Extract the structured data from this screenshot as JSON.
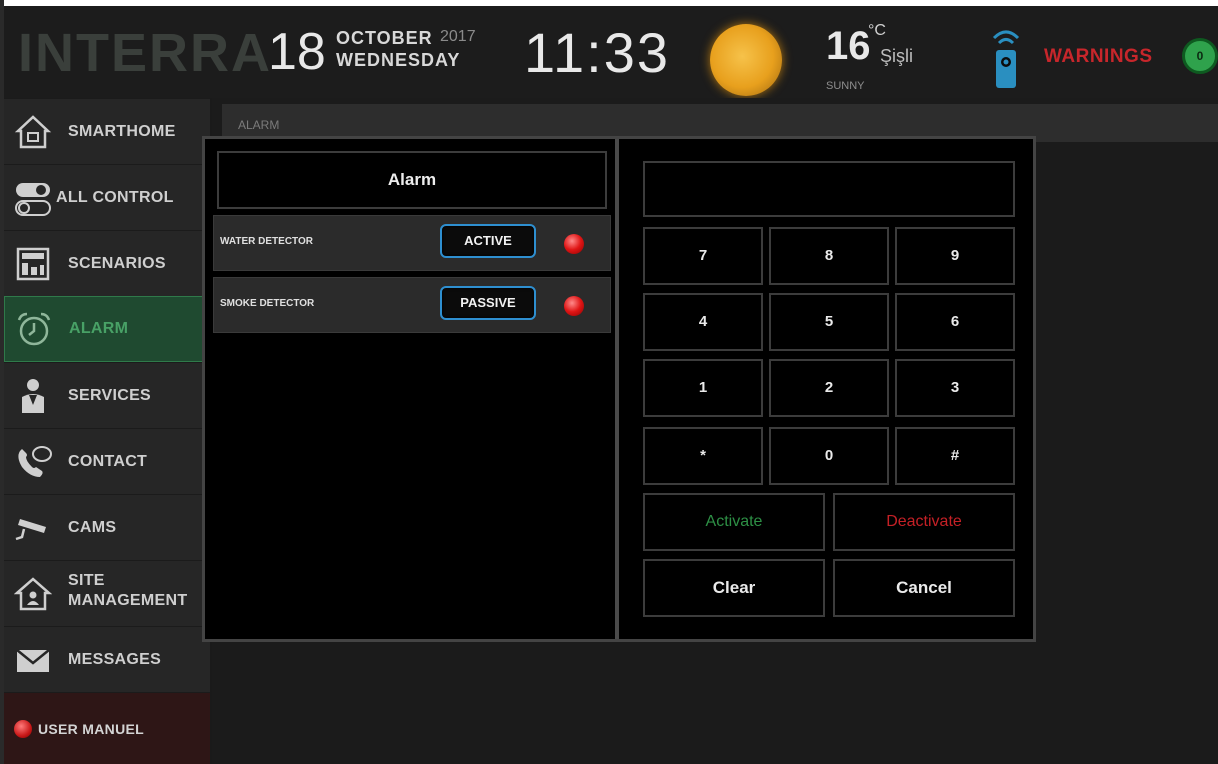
{
  "header": {
    "logo": "INTERRA",
    "day": "18",
    "month": "OCTOBER",
    "year": "2017",
    "weekday": "WEDNESDAY",
    "time": "11:33",
    "temperature": "16",
    "temp_unit": "°C",
    "city": "Şişli",
    "condition": "SUNNY",
    "warnings_label": "WARNINGS",
    "warnings_count": "0"
  },
  "sidebar": {
    "items": [
      {
        "label": "SMARTHOME",
        "icon": "home-icon"
      },
      {
        "label": "ALL CONTROL",
        "icon": "toggle-icon"
      },
      {
        "label": "SCENARIOS",
        "icon": "scenario-icon"
      },
      {
        "label": "ALARM",
        "icon": "alarm-clock-icon"
      },
      {
        "label": "SERVICES",
        "icon": "services-person-icon"
      },
      {
        "label": "CONTACT",
        "icon": "phone-chat-icon"
      },
      {
        "label": "CAMS",
        "icon": "camera-icon"
      },
      {
        "label": "SITE",
        "label2": "MANAGEMENT",
        "icon": "site-home-icon"
      },
      {
        "label": "MESSAGES",
        "icon": "envelope-icon"
      },
      {
        "label": "USER MANUEL",
        "icon": "red-dot-icon"
      }
    ],
    "active": "ALARM"
  },
  "main": {
    "breadcrumb": "ALARM"
  },
  "alarm_dialog": {
    "title": "Alarm",
    "detectors": [
      {
        "label": "WATER DETECTOR",
        "state": "ACTIVE"
      },
      {
        "label": "SMOKE DETECTOR",
        "state": "PASSIVE"
      }
    ],
    "display_value": "",
    "keys": [
      "7",
      "8",
      "9",
      "4",
      "5",
      "6",
      "1",
      "2",
      "3",
      "*",
      "0",
      "#"
    ],
    "activate": "Activate",
    "deactivate": "Deactivate",
    "clear": "Clear",
    "cancel": "Cancel"
  },
  "colors": {
    "active_green": "#2d8f45",
    "warning_red": "#c8262b",
    "button_border_blue": "#2e8fd0"
  }
}
